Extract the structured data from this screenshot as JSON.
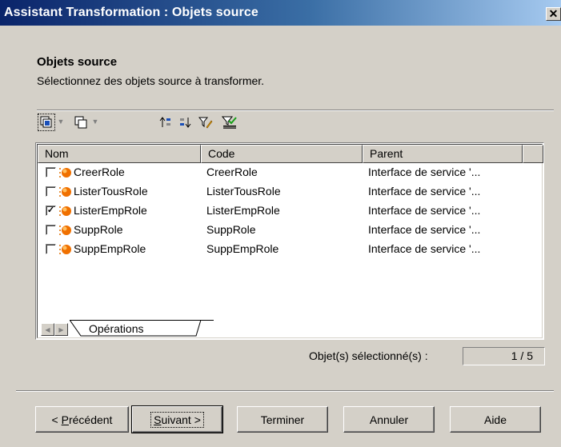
{
  "window": {
    "title": "Assistant Transformation : Objets source",
    "close_label": "✕"
  },
  "section": {
    "title": "Objets source",
    "description": "Sélectionnez des objets source à transformer."
  },
  "toolbar": {
    "icons": [
      "select-all-icon",
      "deselect-all-icon",
      "move-up-icon",
      "move-down-icon",
      "filter-edit-icon",
      "filter-apply-icon"
    ]
  },
  "table": {
    "columns": [
      "Nom",
      "Code",
      "Parent"
    ],
    "rows": [
      {
        "checked": false,
        "name": "CreerRole",
        "code": "CreerRole",
        "parent": "Interface de service '..."
      },
      {
        "checked": false,
        "name": "ListerTousRole",
        "code": "ListerTousRole",
        "parent": "Interface de service '..."
      },
      {
        "checked": true,
        "name": "ListerEmpRole",
        "code": "ListerEmpRole",
        "parent": "Interface de service '..."
      },
      {
        "checked": false,
        "name": "SuppRole",
        "code": "SuppRole",
        "parent": "Interface de service '..."
      },
      {
        "checked": false,
        "name": "SuppEmpRole",
        "code": "SuppEmpRole",
        "parent": "Interface de service '..."
      }
    ],
    "tab_label": "Opérations"
  },
  "selection": {
    "label": "Objet(s) sélectionné(s) :",
    "value": "1 / 5"
  },
  "buttons": {
    "previous": {
      "mnemonic": "P",
      "rest": "récédent",
      "prefix": "< "
    },
    "next": {
      "mnemonic": "S",
      "rest": "uivant >"
    },
    "finish": "Terminer",
    "cancel": "Annuler",
    "help": "Aide"
  },
  "colors": {
    "title_start": "#0a246a",
    "title_end": "#a6caf0",
    "dialog_bg": "#d4d0c8",
    "check_mark": "#000000"
  }
}
